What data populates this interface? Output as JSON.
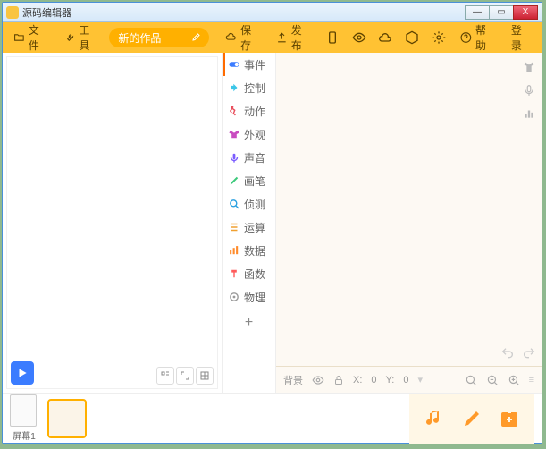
{
  "window": {
    "title": "源码编辑器",
    "min": "—",
    "max": "▭",
    "close": "X"
  },
  "toolbar": {
    "file": "文件",
    "tool": "工具",
    "project": "新的作品",
    "save": "保存",
    "publish": "发布",
    "help": "帮助",
    "login": "登录"
  },
  "categories": [
    {
      "label": "事件",
      "color": "#3b7cff"
    },
    {
      "label": "控制",
      "color": "#3cc6e8"
    },
    {
      "label": "动作",
      "color": "#e84c5a"
    },
    {
      "label": "外观",
      "color": "#c94cc0"
    },
    {
      "label": "声音",
      "color": "#7b5cff"
    },
    {
      "label": "画笔",
      "color": "#3bc97a"
    },
    {
      "label": "侦测",
      "color": "#2aa0e0"
    },
    {
      "label": "运算",
      "color": "#f0a030"
    },
    {
      "label": "数据",
      "color": "#ff8a2a"
    },
    {
      "label": "函数",
      "color": "#ff5c5c"
    },
    {
      "label": "物理",
      "color": "#9a9a9a"
    }
  ],
  "info": {
    "bg": "背景",
    "x": "X:",
    "xval": "0",
    "y": "Y:",
    "yval": "0"
  },
  "bottom": {
    "screen": "屏幕1"
  },
  "plus": "+"
}
